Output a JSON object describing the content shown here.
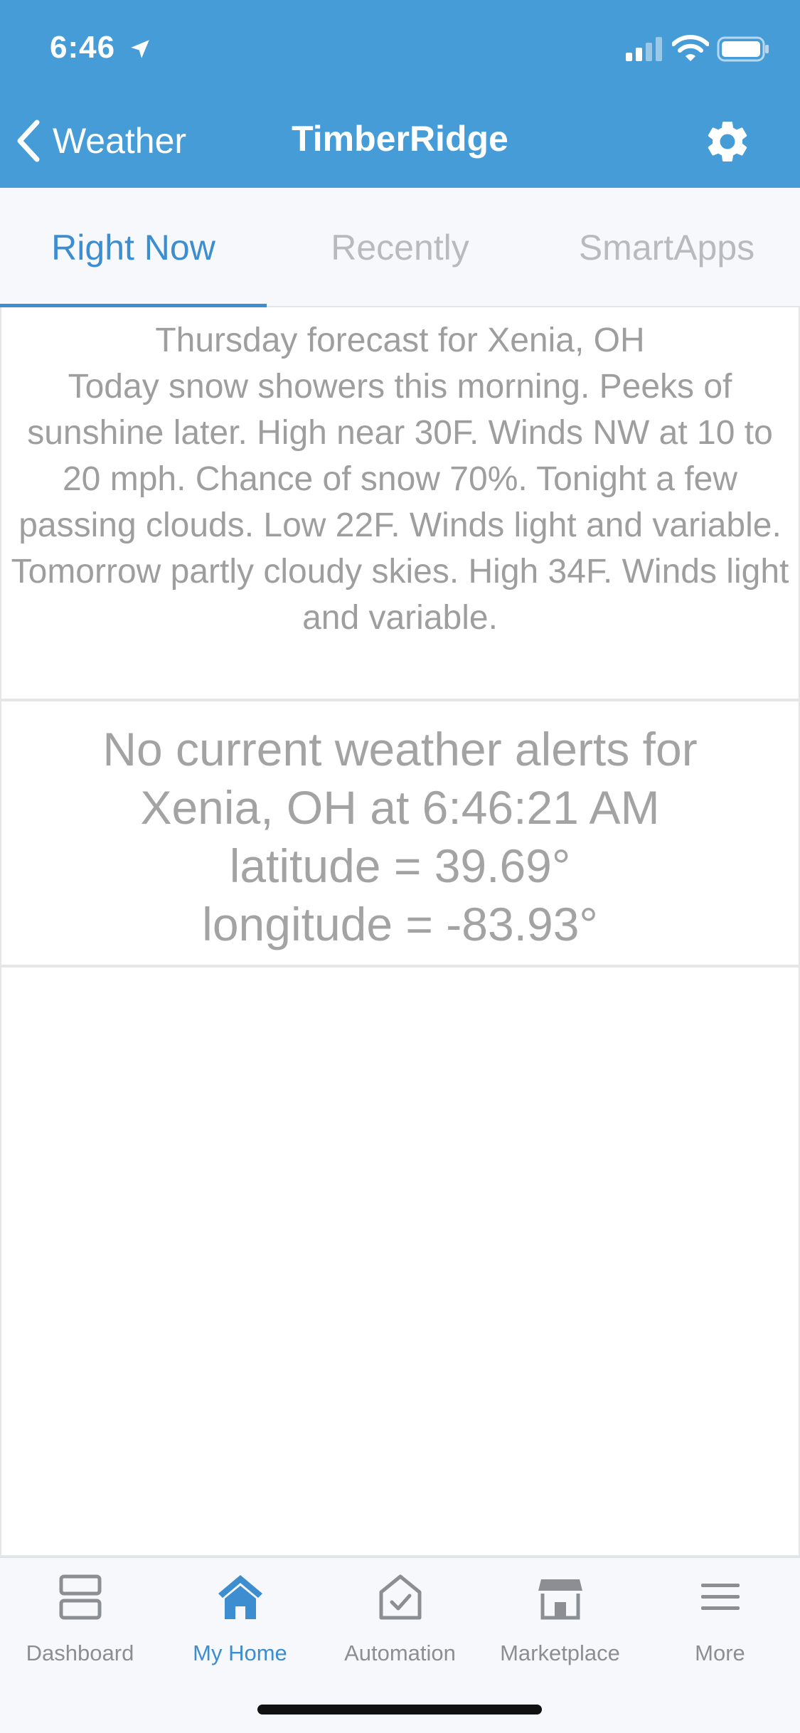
{
  "status_bar": {
    "time": "6:46"
  },
  "nav": {
    "back_label": "Weather",
    "title": "TimberRidge"
  },
  "tabs": [
    {
      "label": "Right Now",
      "active": true
    },
    {
      "label": "Recently",
      "active": false
    },
    {
      "label": "SmartApps",
      "active": false
    }
  ],
  "forecast": {
    "heading": "Thursday forecast for Xenia, OH",
    "text": "Today snow showers this morning. Peeks of sunshine later. High near 30F. Winds NW at 10 to 20 mph. Chance of snow 70%. Tonight a few passing clouds. Low 22F. Winds light and variable. Tomorrow partly cloudy skies. High 34F. Winds light and variable."
  },
  "alerts": {
    "line1": "No current weather alerts for",
    "line2": "Xenia, OH at 6:46:21 AM",
    "latitude": "latitude = 39.69°",
    "longitude": "longitude = -83.93°"
  },
  "tabbar": [
    {
      "label": "Dashboard",
      "icon": "dashboard-icon",
      "active": false
    },
    {
      "label": "My Home",
      "icon": "home-icon",
      "active": true
    },
    {
      "label": "Automation",
      "icon": "automation-icon",
      "active": false
    },
    {
      "label": "Marketplace",
      "icon": "marketplace-icon",
      "active": false
    },
    {
      "label": "More",
      "icon": "menu-icon",
      "active": false
    }
  ],
  "colors": {
    "header": "#469cd6",
    "accent": "#3d8ed0",
    "muted_text": "#9e9e9e"
  }
}
